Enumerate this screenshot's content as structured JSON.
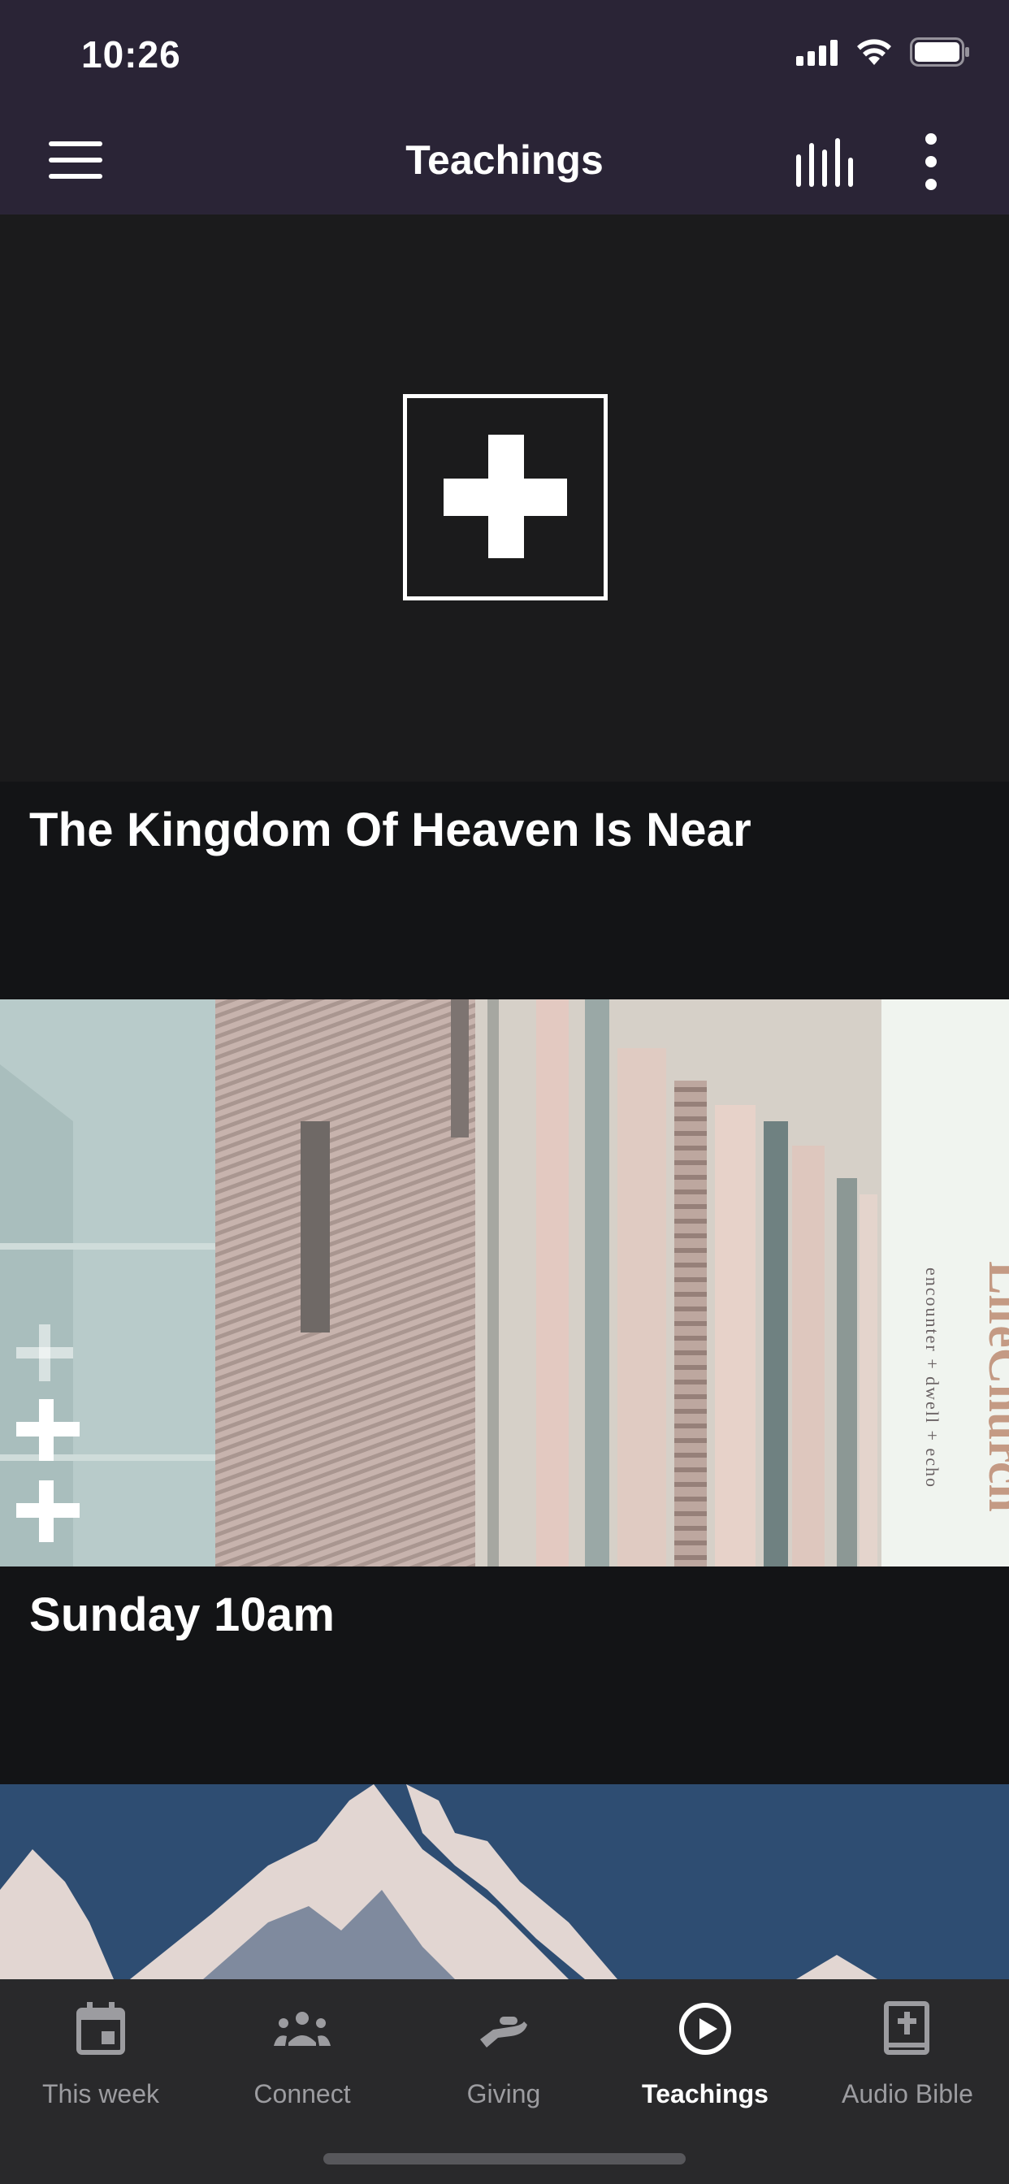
{
  "status_bar": {
    "time": "10:26"
  },
  "app_bar": {
    "title": "Teachings",
    "menu_icon": "hamburger-menu-icon",
    "audio_icon": "audio-bars-icon",
    "more_icon": "more-vertical-icon"
  },
  "cards": [
    {
      "title": "The Kingdom Of Heaven Is Near",
      "image": "cross-logo"
    },
    {
      "title": "Sunday 10am",
      "image": "building-photo",
      "brand": "LifeChurch",
      "tagline": "encounter + dwell + echo"
    },
    {
      "title": "",
      "image": "mountain-illustration"
    }
  ],
  "bottom_nav": {
    "items": [
      {
        "label": "This week",
        "icon": "calendar-icon",
        "active": false
      },
      {
        "label": "Connect",
        "icon": "group-icon",
        "active": false
      },
      {
        "label": "Giving",
        "icon": "giving-hand-icon",
        "active": false
      },
      {
        "label": "Teachings",
        "icon": "play-circle-icon",
        "active": true
      },
      {
        "label": "Audio Bible",
        "icon": "bible-icon",
        "active": false
      }
    ]
  },
  "colors": {
    "header_bg": "#2a2436",
    "content_bg": "#131416",
    "nav_bg": "#29292b",
    "nav_inactive": "#9c9ca0",
    "nav_active": "#ffffff",
    "mountain_bg": "#2e4d72",
    "brand_text": "#c49a84"
  }
}
